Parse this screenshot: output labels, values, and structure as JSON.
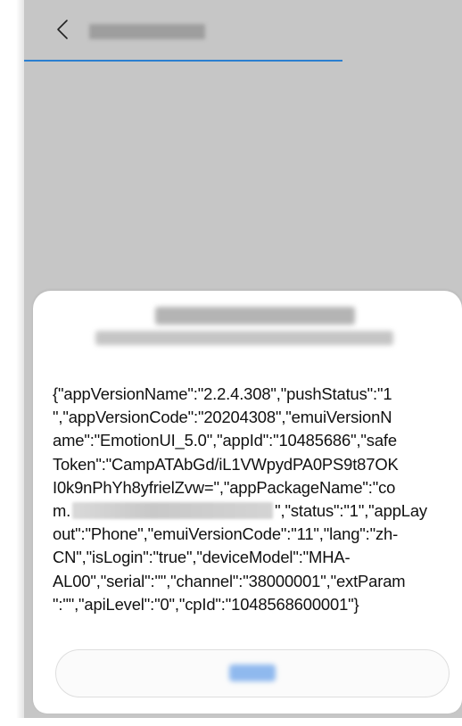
{
  "header": {
    "back_icon": "chevron-left-icon",
    "title": "",
    "accent_color": "#2b7fd0"
  },
  "dialog": {
    "title": "",
    "subtitle": "",
    "body_lines": [
      "{\"appVersionName\":\"2.2.4.308\",\"pushStatus\":\"1",
      "\",\"appVersionCode\":\"20204308\",\"emuiVersionN",
      "ame\":\"EmotionUI_5.0\",\"appId\":\"10485686\",\"safe",
      "Token\":\"CampATAbGd/iL1VWpydPA0PS9t87OK",
      "I0k9nPhYh8yfrielZvw=\",\"appPackageName\":\"co",
      "m."
    ],
    "body_line6_tail": "\",\"status\":\"1\",\"appLay",
    "body_lines_after": [
      "out\":\"Phone\",\"emuiVersionCode\":\"11\",\"lang\":\"zh-",
      "CN\",\"isLogin\":\"true\",\"deviceModel\":\"MHA-",
      "AL00\",\"serial\":\"\",\"channel\":\"38000001\",\"extParam",
      "\":\"\",\"apiLevel\":\"0\",\"cpId\":\"1048568600001\"}"
    ],
    "confirm_label": "",
    "confirm_color": "#8fb9ee"
  }
}
